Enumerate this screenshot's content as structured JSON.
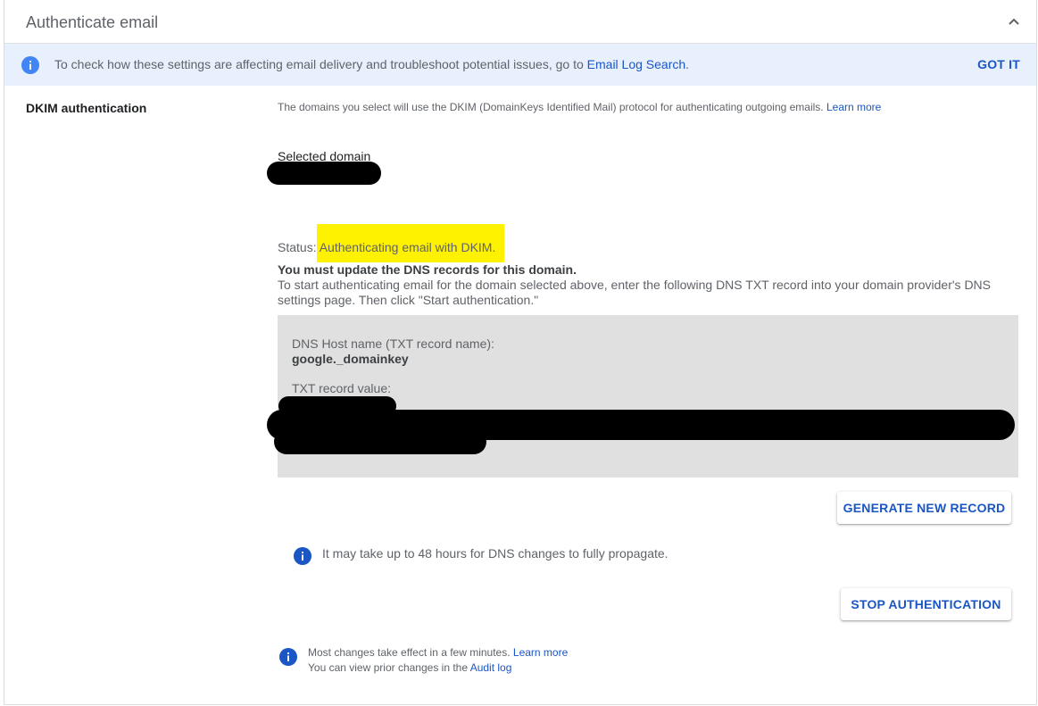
{
  "header": {
    "title": "Authenticate email"
  },
  "banner": {
    "text": "To check how these settings are affecting email delivery and troubleshoot potential issues, go to ",
    "link": "Email Log Search",
    "suffix": ".",
    "dismiss": "GOT IT"
  },
  "dkim": {
    "label": "DKIM authentication",
    "description": "The domains you select will use the DKIM (DomainKeys Identified Mail) protocol for authenticating outgoing emails. ",
    "learn_more": "Learn more",
    "selected_domain_label": "Selected domain",
    "status_prefix": "Status: ",
    "status_value": "Authenticating email with DKIM.",
    "must_update": "You must update the DNS records for this domain.",
    "instructions": "To start authenticating email for the domain selected above, enter the following DNS TXT record into your domain provider's DNS settings page. Then click \"Start authentication.\"",
    "record": {
      "host_label": "DNS Host name (TXT record name):",
      "host_value": "google._domainkey",
      "txt_label": "TXT record value:"
    },
    "generate_button": "GENERATE NEW RECORD",
    "propagation_note": "It may take up to 48 hours for DNS changes to fully propagate.",
    "stop_button": "STOP AUTHENTICATION"
  },
  "footer": {
    "line1": "Most changes take effect in a few minutes. ",
    "line1_link": "Learn more",
    "line2": "You can view prior changes in the ",
    "line2_link": "Audit log"
  },
  "colors": {
    "accent": "#1a56c4",
    "banner_bg": "#e8f0fe",
    "highlight": "#fff200",
    "record_bg": "#e0e0e0"
  }
}
